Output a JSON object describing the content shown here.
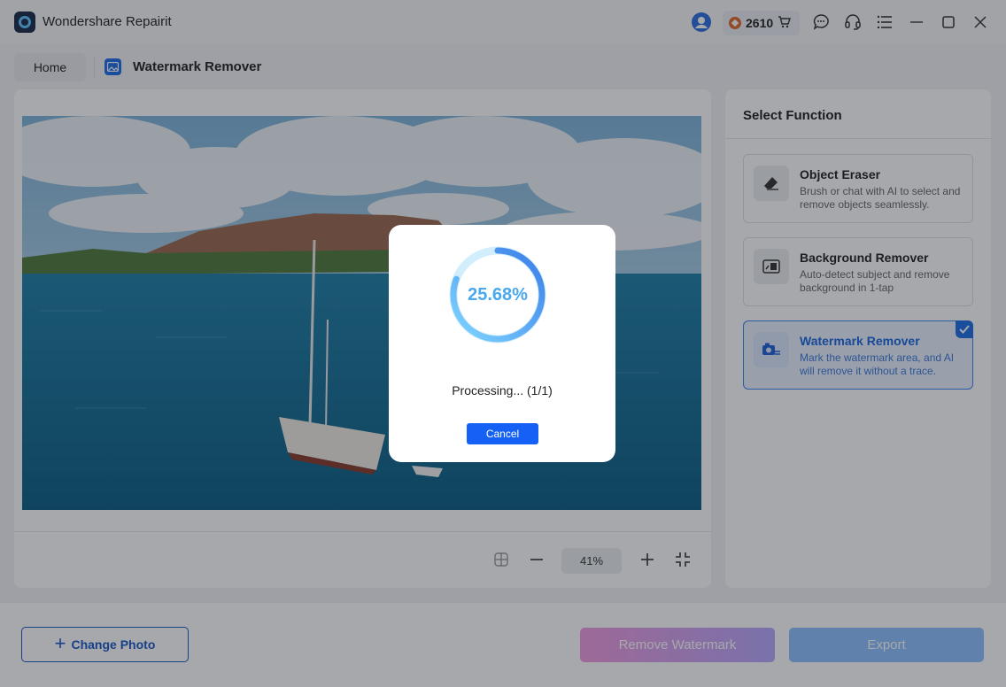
{
  "app": {
    "title": "Wondershare Repairit",
    "credits": "2610"
  },
  "titlebar_icons": [
    "account-icon",
    "cart-icon",
    "feedback-icon",
    "support-icon",
    "menu-icon",
    "minimize-icon",
    "maximize-icon",
    "close-icon"
  ],
  "breadcrumb": {
    "home": "Home",
    "current": "Watermark Remover"
  },
  "canvas": {
    "zoom": "41%"
  },
  "side": {
    "title": "Select Function",
    "functions": [
      {
        "name": "Object Eraser",
        "desc": "Brush or chat with AI to select and remove objects seamlessly.",
        "icon": "eraser-icon",
        "active": false
      },
      {
        "name": "Background Remover",
        "desc": "Auto-detect subject and remove background in 1-tap",
        "icon": "background-remove-icon",
        "active": false
      },
      {
        "name": "Watermark Remover",
        "desc": "Mark the watermark area, and AI will remove it without a trace.",
        "icon": "watermark-icon",
        "active": true
      }
    ]
  },
  "bottom": {
    "change_photo": "Change Photo",
    "remove_watermark": "Remove Watermark",
    "export": "Export"
  },
  "modal": {
    "percent": "25.68%",
    "progress": 0.2568,
    "status": "Processing... (1/1)",
    "cancel": "Cancel"
  },
  "colors": {
    "accent": "#1561f5",
    "progress_ring": "#4aa8ef",
    "active_card": "#eaf2ff"
  }
}
